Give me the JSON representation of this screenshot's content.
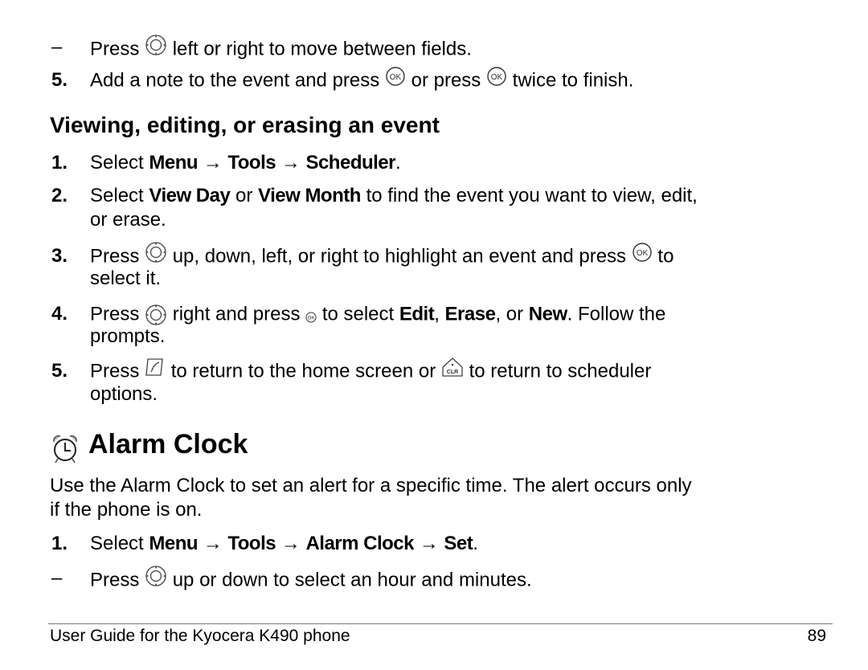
{
  "page": {
    "lines": {
      "l1": {
        "marker": "–",
        "pre": "Press",
        "post": "left or right to move between fields."
      },
      "l2": {
        "marker": "5.",
        "pre": "Add a note to the event and press",
        "mid": "or press",
        "post": "twice to finish."
      }
    },
    "subheading": "Viewing, editing, or erasing an event",
    "steps": {
      "s1": {
        "marker": "1.",
        "pre": "Select",
        "b1": "Menu",
        "arrow": "→",
        "b2": "Tools",
        "b3": "Scheduler",
        "end": "."
      },
      "s2": {
        "marker": "2.",
        "pre": "Select",
        "b1": "View Day",
        "mid": "or",
        "b2": "View Month",
        "post": "to find the event you want to view, edit,",
        "cont": "or erase."
      },
      "s3": {
        "marker": "3.",
        "pre": "Press",
        "mid": "up, down, left, or right to highlight an event and press",
        "post": "to",
        "cont": "select it."
      },
      "s4": {
        "marker": "4.",
        "pre": "Press",
        "mid": "right and press",
        "post": "to select",
        "b1": "Edit",
        "c1": ",",
        "b2": "Erase",
        "c2": ", or",
        "b3": "New",
        "end": ". Follow the",
        "cont": "prompts."
      },
      "s5": {
        "marker": "5.",
        "pre": "Press",
        "mid": "to return to the home screen or",
        "post": "to return to scheduler",
        "cont": "options."
      }
    },
    "section_title": "Alarm Clock",
    "intro_1": "Use the Alarm Clock to set an alert for a specific time. The alert occurs only",
    "intro_2": "if the phone is on.",
    "alarm_steps": {
      "a1": {
        "marker": "1.",
        "pre": "Select",
        "b1": "Menu",
        "arrow": "→",
        "b2": "Tools",
        "b3": "Alarm Clock",
        "b4": "Set",
        "end": "."
      },
      "a2": {
        "marker": "–",
        "pre": "Press",
        "post": "up or down to select an hour and minutes."
      }
    },
    "footer": {
      "title": "User Guide for the Kyocera K490 phone",
      "page_number": "89"
    },
    "icons": {
      "nav": "navigation-key-icon",
      "ok": "ok-key-icon",
      "end": "end-key-icon",
      "clr": "clear-key-icon",
      "alarm": "alarm-clock-icon"
    }
  }
}
